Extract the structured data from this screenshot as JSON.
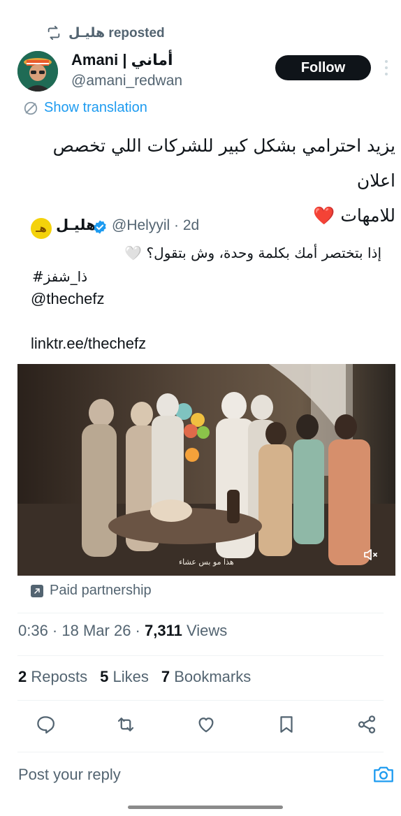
{
  "repost": {
    "label": "هليـل reposted"
  },
  "author": {
    "name": "Amani | أماني",
    "handle": "@amani_redwan"
  },
  "follow_label": "Follow",
  "translate_label": "Show translation",
  "tweet": {
    "line1": "يزيد احترامي بشكل كبير للشركات اللي تخصص اعلان",
    "line2": "للامهات ❤️"
  },
  "quoted": {
    "badge": "هـ",
    "name": "هليـل",
    "handle": "@Helyyil · 2d",
    "line1": "إذا بتختصر أمك بكلمة وحدة، وش بتقول؟ 🤍",
    "line2": "#ذا_شفز",
    "line3": "@thechefz",
    "line4": "linktr.ee/thechefz"
  },
  "media": {
    "caption": "هذا مو بس عشاء"
  },
  "paid_label": "Paid partnership",
  "meta": {
    "time_date": "0:36 · 18 Mar 26 · ",
    "views_count": "7,311",
    "views_label": "Views"
  },
  "stats": {
    "reposts_count": "2",
    "reposts_label": "Reposts",
    "likes_count": "5",
    "likes_label": "Likes",
    "bookmarks_count": "7",
    "bookmarks_label": "Bookmarks"
  },
  "reply_placeholder": "Post your reply",
  "colors": {
    "accent": "#1d9bf0",
    "text": "#0f1419",
    "secondary": "#536471",
    "heart": "#e0245e"
  },
  "icons": [
    "repost-icon",
    "translate-icon",
    "verified-icon",
    "mute-icon",
    "paid-partnership-icon",
    "reply-icon",
    "retweet-icon",
    "like-icon",
    "bookmark-icon",
    "share-icon",
    "camera-icon"
  ]
}
